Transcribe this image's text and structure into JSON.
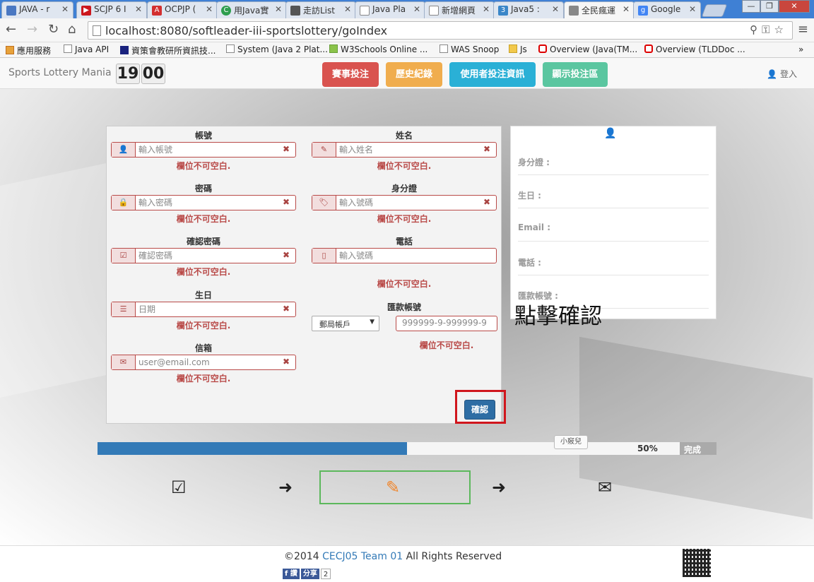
{
  "browser": {
    "tabs": [
      {
        "title": "JAVA - r",
        "favicon_color": "#4a78c2"
      },
      {
        "title": "SCJP 6 I",
        "favicon_color": "#cc181e"
      },
      {
        "title": "OCPJP (",
        "favicon_color": "#d32f2f"
      },
      {
        "title": "用Java實",
        "favicon_color": "#2e9e4e"
      },
      {
        "title": "走訪List",
        "favicon_color": "#555555"
      },
      {
        "title": "Java Pla",
        "favicon_color": "#ffffff"
      },
      {
        "title": "新增網頁",
        "favicon_color": "#ffffff"
      },
      {
        "title": "Java5 :",
        "favicon_color": "#3a86c8"
      },
      {
        "title": "全民瘋運",
        "favicon_color": "#888888",
        "active": true
      },
      {
        "title": "Google",
        "favicon_color": "#4285f4"
      }
    ],
    "url": "localhost:8080/softleader-iii-sportslottery/goIndex",
    "bookmarks": [
      "應用服務",
      "Java API",
      "資策會教研所資訊技...",
      "System (Java 2 Plat...",
      "W3Schools Online ...",
      "WAS Snoop",
      "Js",
      "Overview (Java(TM...",
      "Overview (TLDDoc ..."
    ]
  },
  "navbar": {
    "brand": "Sports Lottery Mania",
    "clock": {
      "hour": "19",
      "minute": "00"
    },
    "buttons": [
      {
        "label": "賽事投注",
        "color": "#d9534f"
      },
      {
        "label": "歷史紀錄",
        "color": "#f0ad4e"
      },
      {
        "label": "使用者投注資訊",
        "color": "#2ab0d6"
      },
      {
        "label": "顯示投注區",
        "color": "#5bc6a0"
      }
    ],
    "login": "登入"
  },
  "form": {
    "account": {
      "label": "帳號",
      "placeholder": "輸入帳號",
      "error": "欄位不可空白."
    },
    "name": {
      "label": "姓名",
      "placeholder": "輸入姓名",
      "error": "欄位不可空白."
    },
    "password": {
      "label": "密碼",
      "placeholder": "輸入密碼",
      "error": "欄位不可空白."
    },
    "id_number": {
      "label": "身分證",
      "placeholder": "輸入號碼",
      "error": "欄位不可空白."
    },
    "confirm_password": {
      "label": "確認密碼",
      "placeholder": "確認密碼",
      "error": "欄位不可空白."
    },
    "phone": {
      "label": "電話",
      "placeholder": "輸入號碼",
      "error": "欄位不可空白."
    },
    "birthday": {
      "label": "生日",
      "placeholder": "日期",
      "error": "欄位不可空白."
    },
    "bank_account": {
      "label": "匯款帳號",
      "select_value": "郵局帳戶",
      "placeholder": "999999-9-999999-9",
      "error": "欄位不可空白."
    },
    "email": {
      "label": "信箱",
      "placeholder": "user@email.com",
      "error": "欄位不可空白."
    },
    "confirm_button": "確認"
  },
  "info_panel": {
    "rows": [
      "身分證 :",
      "生日 :",
      "Email :",
      "電話 :",
      "匯款帳號 :"
    ]
  },
  "annotation": "點擊確認",
  "progress": {
    "value": 0.5,
    "percent_label": "50%",
    "done_label": "完成",
    "tooltip": "小竅兒"
  },
  "footer": {
    "copyright_prefix": "©2014 ",
    "team_link": "CECJ05 Team 01",
    "copyright_suffix": " All Rights Reserved",
    "share": {
      "like": "讚",
      "share": "分享",
      "count": "2"
    }
  }
}
